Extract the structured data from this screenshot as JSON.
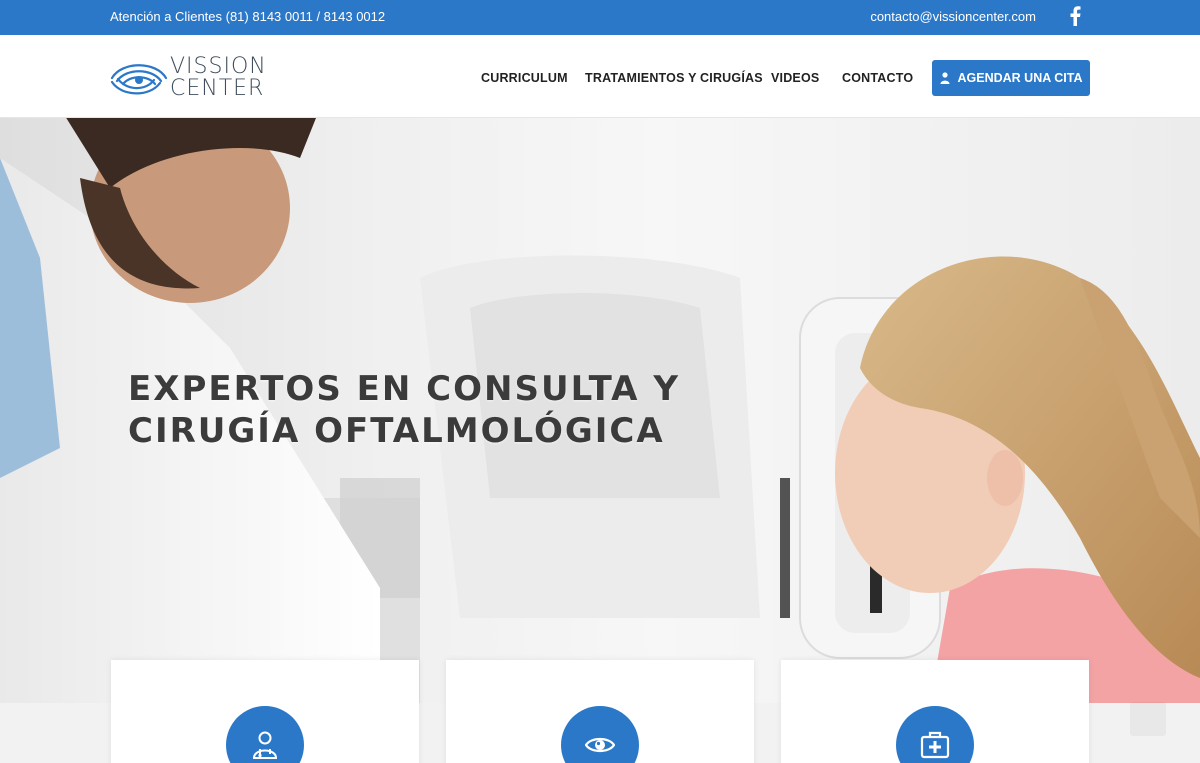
{
  "topbar": {
    "phone": "Atención a Clientes (81) 8143 0011 / 8143 0012",
    "email": "contacto@vissioncenter.com",
    "social_icon": "facebook-icon"
  },
  "header": {
    "logo_line1": "VISSION",
    "logo_line2": "CENTER",
    "nav": [
      "CURRICULUM",
      "TRATAMIENTOS Y CIRUGÍAS",
      "VIDEOS",
      "CONTACTO"
    ],
    "cta_label": "AGENDAR UNA CITA",
    "cta_icon": "doctor-icon"
  },
  "hero": {
    "title_line1": "EXPERTOS EN CONSULTA Y",
    "title_line2": "CIRUGÍA OFTALMOLÓGICA"
  },
  "cards": [
    {
      "icon": "doctor-icon"
    },
    {
      "icon": "eye-icon"
    },
    {
      "icon": "medical-kit-icon"
    }
  ],
  "colors": {
    "brand_blue": "#2b78c9",
    "white": "#ffffff",
    "title_gray": "#3b3b3b"
  }
}
